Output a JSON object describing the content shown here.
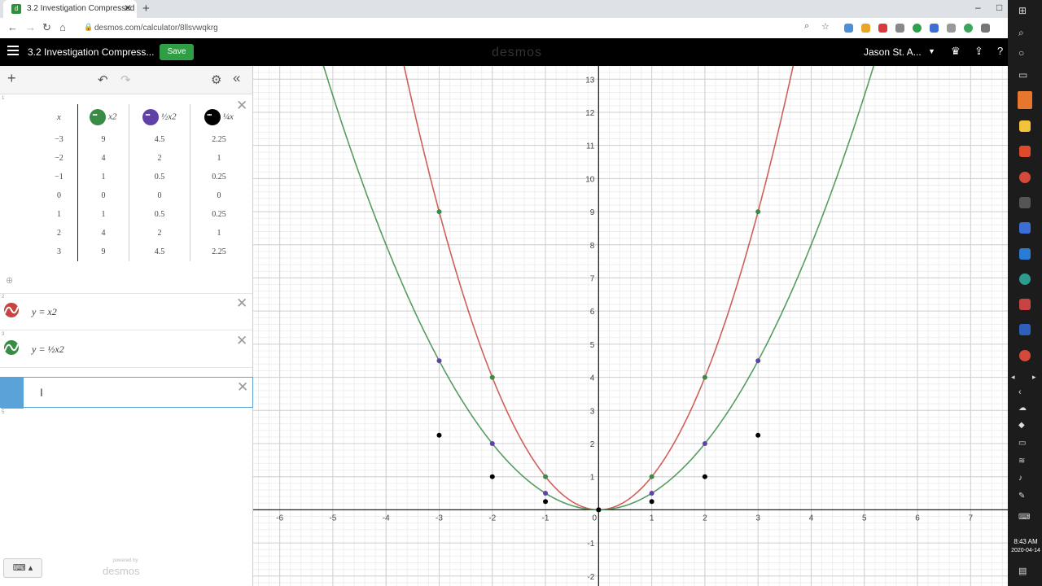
{
  "browser": {
    "tab_title": "3.2 Investigation Compressed",
    "tab_close": "✕",
    "new_tab": "+",
    "url": "desmos.com/calculator/8llsvwqkrg",
    "window_controls": [
      "–",
      "□"
    ]
  },
  "header": {
    "title": "3.2 Investigation Compress...",
    "save_label": "Save",
    "brand": "desmos",
    "user": "Jason St. A...",
    "icons": [
      "trophy-icon",
      "share-icon",
      "help-icon"
    ]
  },
  "toolbar": {
    "add": "+",
    "undo": "↶",
    "redo": "↷",
    "settings": "⚙",
    "collapse": "«"
  },
  "table": {
    "headers": [
      "x",
      "x2",
      "½x2",
      "¼x"
    ],
    "header_colors": [
      "",
      "#388c46",
      "#6042a6",
      "#000000"
    ],
    "rows": [
      [
        "−3",
        "9",
        "4.5",
        "2.25"
      ],
      [
        "−2",
        "4",
        "2",
        "1"
      ],
      [
        "−1",
        "1",
        "0.5",
        "0.25"
      ],
      [
        "0",
        "0",
        "0",
        "0"
      ],
      [
        "1",
        "1",
        "0.5",
        "0.25"
      ],
      [
        "2",
        "4",
        "2",
        "1"
      ],
      [
        "3",
        "9",
        "4.5",
        "2.25"
      ]
    ]
  },
  "expressions": [
    {
      "latex": "y = x2",
      "color": "#c74440"
    },
    {
      "latex": "y = ½x2",
      "color": "#388c46"
    }
  ],
  "footer": {
    "keyboard": "⌨ ▴",
    "powered_by": "powered by",
    "brand": "desmos"
  },
  "chart_data": {
    "type": "line",
    "xlim": [
      -6.5,
      7.7
    ],
    "ylim": [
      -2.3,
      13.4
    ],
    "x_ticks": [
      -6,
      -5,
      -4,
      -3,
      -2,
      -1,
      0,
      1,
      2,
      3,
      4,
      5,
      6,
      7
    ],
    "y_ticks": [
      -2,
      -1,
      1,
      2,
      3,
      4,
      5,
      6,
      7,
      8,
      9,
      10,
      11,
      12,
      13
    ],
    "grid": true,
    "series": [
      {
        "expr": "x^2",
        "color": "#c74440"
      },
      {
        "expr": "0.5*x^2",
        "color": "#388c46"
      }
    ],
    "points": [
      {
        "color": "#388c46",
        "x": [
          -3,
          -2,
          -1,
          0,
          1,
          2,
          3
        ],
        "y": [
          9,
          4,
          1,
          0,
          1,
          4,
          9
        ]
      },
      {
        "color": "#6042a6",
        "x": [
          -3,
          -2,
          -1,
          0,
          1,
          2,
          3
        ],
        "y": [
          4.5,
          2,
          0.5,
          0,
          0.5,
          2,
          4.5
        ]
      },
      {
        "color": "#000000",
        "x": [
          -3,
          -2,
          -1,
          0,
          1,
          2,
          3
        ],
        "y": [
          2.25,
          1,
          0.25,
          0,
          0.25,
          1,
          2.25
        ]
      }
    ]
  },
  "taskbar": {
    "time": "8:43 AM",
    "date": "2020-04-14"
  }
}
